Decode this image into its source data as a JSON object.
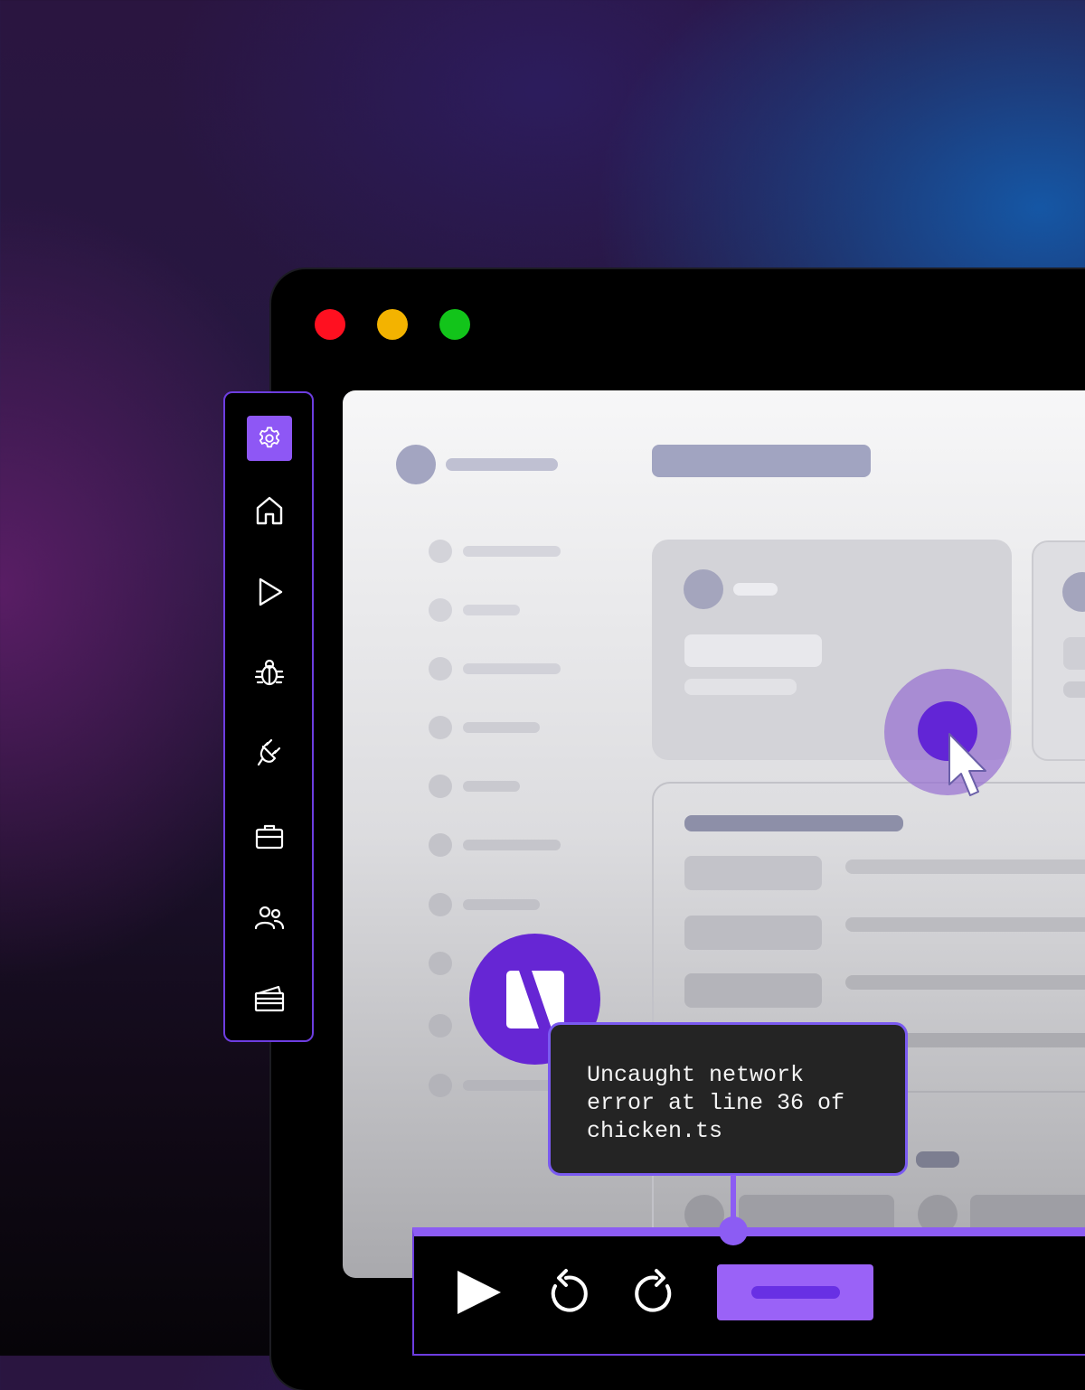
{
  "window": {
    "controls": [
      {
        "name": "close",
        "color": "#ff1020"
      },
      {
        "name": "minimize",
        "color": "#f3b300"
      },
      {
        "name": "maximize",
        "color": "#12c41a"
      }
    ]
  },
  "sidebar": {
    "items": [
      {
        "icon": "gear-icon",
        "active": true
      },
      {
        "icon": "home-icon"
      },
      {
        "icon": "play-icon"
      },
      {
        "icon": "bug-icon"
      },
      {
        "icon": "plug-icon"
      },
      {
        "icon": "briefcase-icon"
      },
      {
        "icon": "users-icon"
      },
      {
        "icon": "card-icon"
      }
    ],
    "accent": "#8e57f5"
  },
  "tooltip": {
    "message": "Uncaught network\nerror at line 36 of\nchicken.ts"
  },
  "badge": {
    "icon": "logo-icon",
    "color": "#6626d4"
  },
  "toolbar": {
    "buttons": [
      "play-icon",
      "undo-icon",
      "redo-icon"
    ],
    "primary_color": "#9a62f7"
  }
}
